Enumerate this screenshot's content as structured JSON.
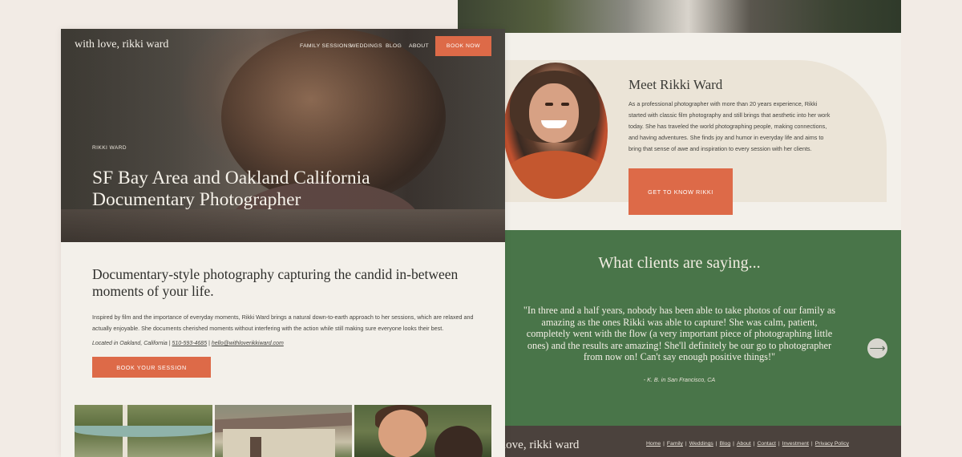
{
  "left_page": {
    "logo": "with love, rikki ward",
    "nav": {
      "family_sessions": "FAMILY SESSIONS",
      "weddings": "WEDDINGS",
      "blog": "BLOG",
      "about": "ABOUT",
      "book_now": "BOOK NOW"
    },
    "hero": {
      "eyebrow": "RIKKI WARD",
      "title": "SF Bay Area and Oakland California Documentary Photographer"
    },
    "intro": {
      "heading": "Documentary-style photography capturing the candid in-between moments of your life.",
      "body": "Inspired by film and the importance of everyday moments, Rikki Ward brings a natural down-to-earth approach to her sessions, which are relaxed and actually enjoyable. She documents cherished moments without interfering with the action while still making sure everyone looks their best.",
      "location": "Located in Oakland, California | ",
      "phone": "510-593-4685",
      "separator": " | ",
      "email": "hello@withloverikkiward.com",
      "cta": "BOOK YOUR SESSION"
    }
  },
  "right_page": {
    "meet": {
      "title": "Meet Rikki Ward",
      "body": "As a professional photographer with more than 20 years experience, Rikki started with classic film photography and still brings that aesthetic into her work today. She has traveled the world photographing people, making connections, and having adventures. She finds joy and humor in everyday life and aims to bring that sense of awe and inspiration to every session with her clients.",
      "cta": "GET TO KNOW RIKKI"
    },
    "testimonials": {
      "title": "What clients are saying...",
      "quote": "\"In three and a half years, nobody has been able to take photos of our family as amazing as the ones Rikki was able to capture! She was calm, patient, completely went with the flow (a very important piece of photographing little ones) and the results are amazing! She'll definitely be our go to photographer from now on! Can't say enough positive things!\"",
      "cite": "- K. B. in San Francisco, CA",
      "next_arrow": "⟶"
    },
    "footer": {
      "logo": "love, rikki ward",
      "links": [
        "Home",
        "Family",
        "Weddings",
        "Blog",
        "About",
        "Contact",
        "Investment",
        "Privacy Policy"
      ],
      "separator": "|"
    }
  },
  "colors": {
    "background": "#f2ebe5",
    "accent": "#dd6a48",
    "green": "#497549",
    "footer": "#4b423d",
    "panel": "#ebe4d7"
  }
}
